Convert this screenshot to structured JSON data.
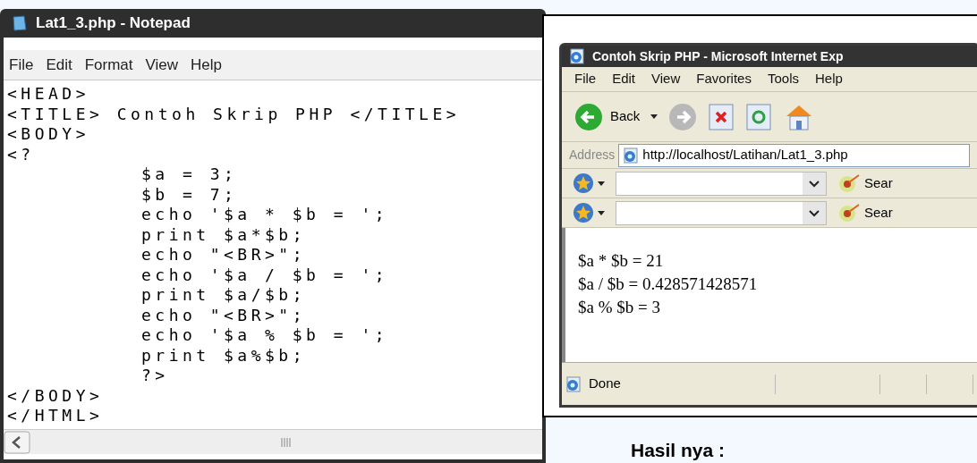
{
  "notepad": {
    "title": "Lat1_3.php - Notepad",
    "menu": [
      "File",
      "Edit",
      "Format",
      "View",
      "Help"
    ],
    "lines": [
      {
        "text": "<HEAD>"
      },
      {
        "text": "<TITLE> Contoh Skrip PHP </TITLE>"
      },
      {
        "text": "<BODY>"
      },
      {
        "text": "<?",
        "children": [
          {
            "text": "$a = 3;"
          },
          {
            "text": "$b = 7;"
          },
          {
            "text": "echo '$a * $b = ';"
          },
          {
            "text": "print $a*$b;"
          },
          {
            "text": "echo \"<BR>\";"
          },
          {
            "text": "echo '$a / $b = ';"
          },
          {
            "text": "print $a/$b;"
          },
          {
            "text": "echo \"<BR>\";"
          },
          {
            "text": "echo '$a % $b = ';"
          },
          {
            "text": "print $a%$b;"
          },
          {
            "text": "?>"
          }
        ]
      },
      {
        "text": "</BODY>"
      },
      {
        "text": "</HTML>"
      }
    ]
  },
  "browser": {
    "title": "Contoh Skrip PHP - Microsoft Internet Exp",
    "menu": [
      "File",
      "Edit",
      "View",
      "Favorites",
      "Tools",
      "Help"
    ],
    "back_label": "Back",
    "address_label": "Address",
    "address": "http://localhost/Latihan/Lat1_3.php",
    "search_bars": [
      {
        "label": "Sear"
      },
      {
        "label": "Sear"
      }
    ],
    "output": [
      "$a * $b = 21",
      "$a / $b = 0.428571428571",
      "$a % $b = 3"
    ],
    "status": "Done"
  },
  "caption": "Hasil nya :"
}
